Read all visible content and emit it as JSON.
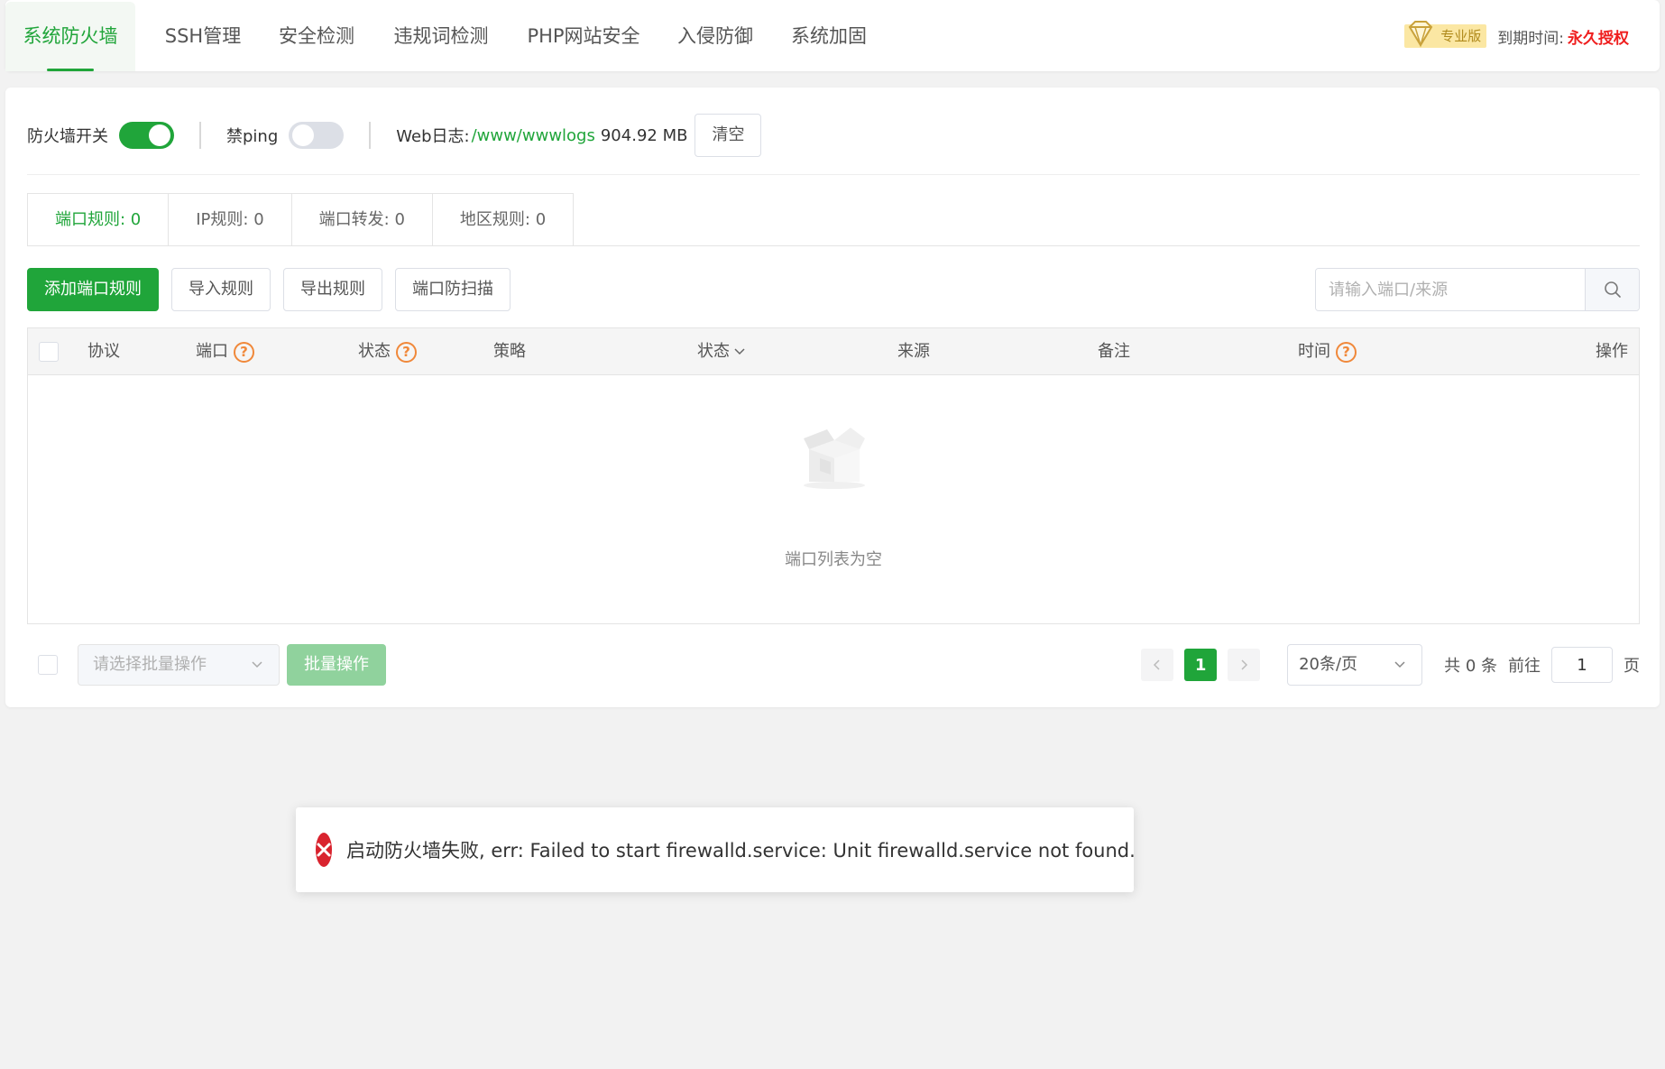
{
  "nav": {
    "tabs": [
      {
        "label": "系统防火墙"
      },
      {
        "label": "SSH管理"
      },
      {
        "label": "安全检测"
      },
      {
        "label": "违规词检测"
      },
      {
        "label": "PHP网站安全"
      },
      {
        "label": "入侵防御"
      },
      {
        "label": "系统加固"
      }
    ],
    "pro_badge": "专业版",
    "expire_label": "到期时间:",
    "expire_value": "永久授权"
  },
  "toolbar": {
    "firewall_label": "防火墙开关",
    "firewall_on": true,
    "ping_label": "禁ping",
    "ping_on": false,
    "weblog_label": "Web日志:",
    "weblog_path": "/www/wwwlogs",
    "weblog_size": "904.92 MB",
    "clear_label": "清空"
  },
  "subtabs": [
    {
      "label": "端口规则: 0"
    },
    {
      "label": "IP规则: 0"
    },
    {
      "label": "端口转发: 0"
    },
    {
      "label": "地区规则: 0"
    }
  ],
  "actions": {
    "add": "添加端口规则",
    "import": "导入规则",
    "export": "导出规则",
    "scan": "端口防扫描",
    "search_placeholder": "请输入端口/来源"
  },
  "table": {
    "columns": {
      "protocol": "协议",
      "port": "端口",
      "status": "状态",
      "policy": "策略",
      "state": "状态",
      "source": "来源",
      "remark": "备注",
      "time": "时间",
      "action": "操作"
    },
    "empty_text": "端口列表为空"
  },
  "footer": {
    "batch_placeholder": "请选择批量操作",
    "batch_button": "批量操作",
    "current_page": "1",
    "page_size": "20条/页",
    "total": "共 0 条",
    "goto_label": "前往",
    "goto_value": "1",
    "page_unit": "页"
  },
  "toast": {
    "message": "启动防火墙失败, err: Failed to start firewalld.service: Unit firewalld.service not found."
  },
  "colors": {
    "accent": "#20a53a",
    "error": "#d9232e",
    "warning": "#f0883a",
    "expire": "#ef1e1e"
  }
}
